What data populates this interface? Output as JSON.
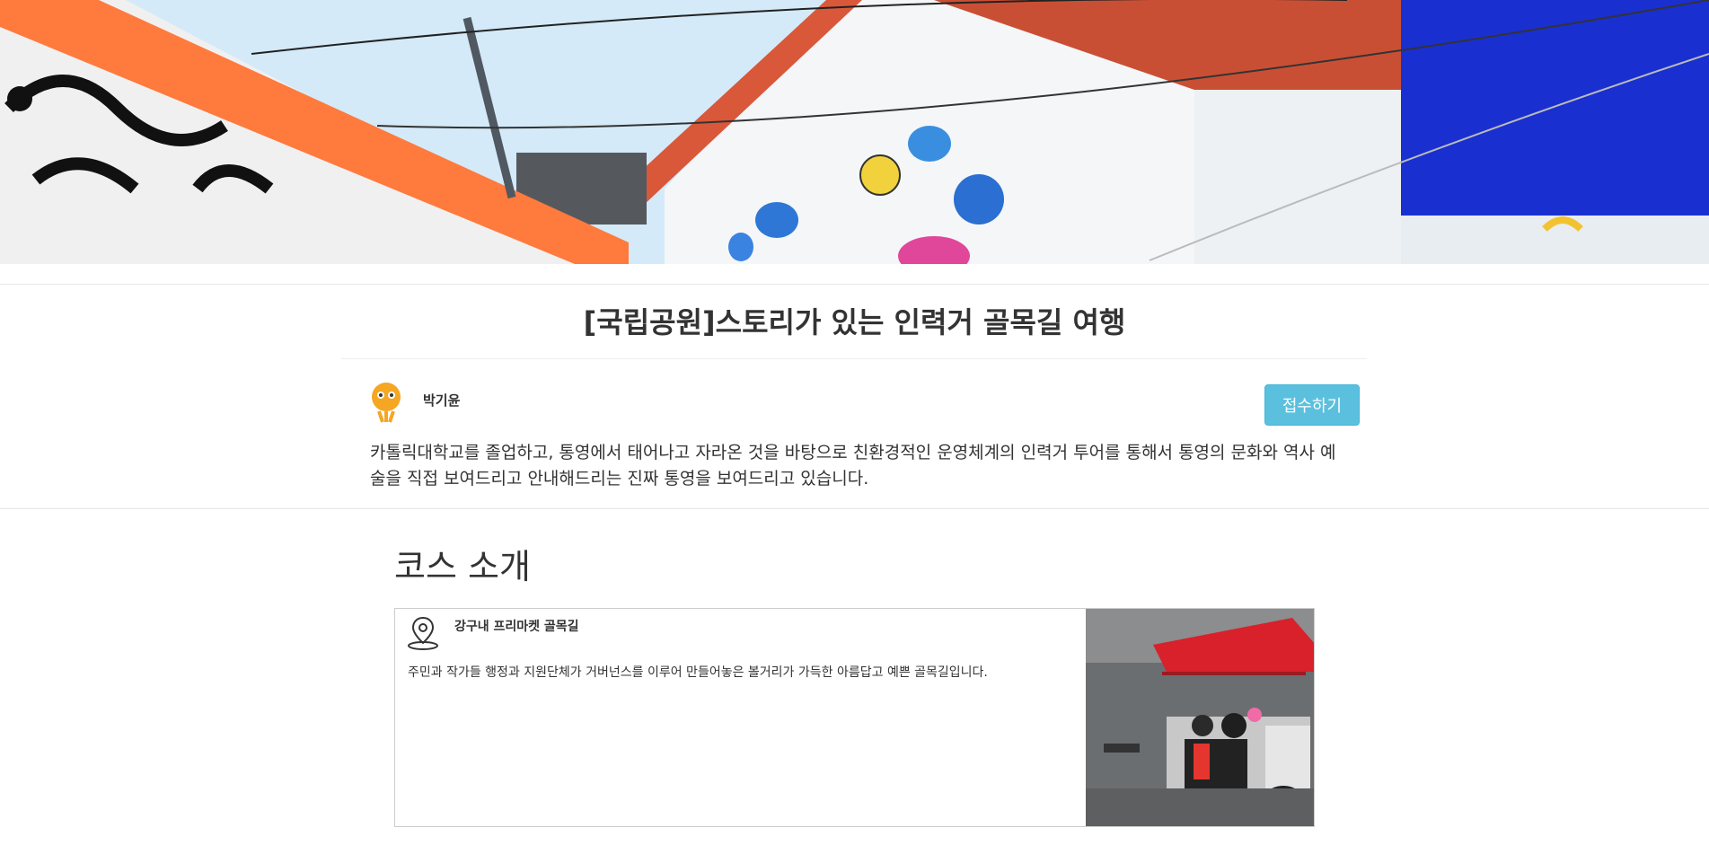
{
  "hero": {
    "image": "alley-mural-photo"
  },
  "page": {
    "title": "[국립공원]스토리가 있는 인력거 골목길 여행"
  },
  "guide": {
    "avatar_icon": "guide-avatar-icon",
    "name": "박기윤",
    "apply_label": "접수하기",
    "bio": "카톨릭대학교를 졸업하고, 통영에서 태어나고 자라온 것을 바탕으로 친환경적인 운영체계의 인력거 투어를 통해서 통영의 문화와 역사 예술을 직접 보여드리고 안내해드리는 진짜 통영을 보여드리고 있습니다."
  },
  "course": {
    "heading": "코스 소개",
    "stops": [
      {
        "icon": "location-pin-icon",
        "name": "강구내 프리마켓 골목길",
        "description": "주민과 작가들 행정과 지원단체가 거버넌스를 이루어 만들어놓은 볼거리가 가득한 아름답고 예쁜 골목길입니다."
      }
    ]
  },
  "colors": {
    "button": "#5bc0de",
    "text": "#333333"
  }
}
